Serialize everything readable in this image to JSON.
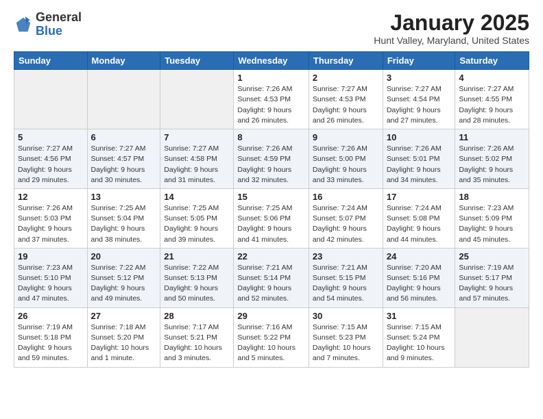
{
  "header": {
    "logo_general": "General",
    "logo_blue": "Blue",
    "month_title": "January 2025",
    "location": "Hunt Valley, Maryland, United States"
  },
  "weekdays": [
    "Sunday",
    "Monday",
    "Tuesday",
    "Wednesday",
    "Thursday",
    "Friday",
    "Saturday"
  ],
  "weeks": [
    [
      {
        "day": "",
        "content": ""
      },
      {
        "day": "",
        "content": ""
      },
      {
        "day": "",
        "content": ""
      },
      {
        "day": "1",
        "content": "Sunrise: 7:26 AM\nSunset: 4:53 PM\nDaylight: 9 hours\nand 26 minutes."
      },
      {
        "day": "2",
        "content": "Sunrise: 7:27 AM\nSunset: 4:53 PM\nDaylight: 9 hours\nand 26 minutes."
      },
      {
        "day": "3",
        "content": "Sunrise: 7:27 AM\nSunset: 4:54 PM\nDaylight: 9 hours\nand 27 minutes."
      },
      {
        "day": "4",
        "content": "Sunrise: 7:27 AM\nSunset: 4:55 PM\nDaylight: 9 hours\nand 28 minutes."
      }
    ],
    [
      {
        "day": "5",
        "content": "Sunrise: 7:27 AM\nSunset: 4:56 PM\nDaylight: 9 hours\nand 29 minutes."
      },
      {
        "day": "6",
        "content": "Sunrise: 7:27 AM\nSunset: 4:57 PM\nDaylight: 9 hours\nand 30 minutes."
      },
      {
        "day": "7",
        "content": "Sunrise: 7:27 AM\nSunset: 4:58 PM\nDaylight: 9 hours\nand 31 minutes."
      },
      {
        "day": "8",
        "content": "Sunrise: 7:26 AM\nSunset: 4:59 PM\nDaylight: 9 hours\nand 32 minutes."
      },
      {
        "day": "9",
        "content": "Sunrise: 7:26 AM\nSunset: 5:00 PM\nDaylight: 9 hours\nand 33 minutes."
      },
      {
        "day": "10",
        "content": "Sunrise: 7:26 AM\nSunset: 5:01 PM\nDaylight: 9 hours\nand 34 minutes."
      },
      {
        "day": "11",
        "content": "Sunrise: 7:26 AM\nSunset: 5:02 PM\nDaylight: 9 hours\nand 35 minutes."
      }
    ],
    [
      {
        "day": "12",
        "content": "Sunrise: 7:26 AM\nSunset: 5:03 PM\nDaylight: 9 hours\nand 37 minutes."
      },
      {
        "day": "13",
        "content": "Sunrise: 7:25 AM\nSunset: 5:04 PM\nDaylight: 9 hours\nand 38 minutes."
      },
      {
        "day": "14",
        "content": "Sunrise: 7:25 AM\nSunset: 5:05 PM\nDaylight: 9 hours\nand 39 minutes."
      },
      {
        "day": "15",
        "content": "Sunrise: 7:25 AM\nSunset: 5:06 PM\nDaylight: 9 hours\nand 41 minutes."
      },
      {
        "day": "16",
        "content": "Sunrise: 7:24 AM\nSunset: 5:07 PM\nDaylight: 9 hours\nand 42 minutes."
      },
      {
        "day": "17",
        "content": "Sunrise: 7:24 AM\nSunset: 5:08 PM\nDaylight: 9 hours\nand 44 minutes."
      },
      {
        "day": "18",
        "content": "Sunrise: 7:23 AM\nSunset: 5:09 PM\nDaylight: 9 hours\nand 45 minutes."
      }
    ],
    [
      {
        "day": "19",
        "content": "Sunrise: 7:23 AM\nSunset: 5:10 PM\nDaylight: 9 hours\nand 47 minutes."
      },
      {
        "day": "20",
        "content": "Sunrise: 7:22 AM\nSunset: 5:12 PM\nDaylight: 9 hours\nand 49 minutes."
      },
      {
        "day": "21",
        "content": "Sunrise: 7:22 AM\nSunset: 5:13 PM\nDaylight: 9 hours\nand 50 minutes."
      },
      {
        "day": "22",
        "content": "Sunrise: 7:21 AM\nSunset: 5:14 PM\nDaylight: 9 hours\nand 52 minutes."
      },
      {
        "day": "23",
        "content": "Sunrise: 7:21 AM\nSunset: 5:15 PM\nDaylight: 9 hours\nand 54 minutes."
      },
      {
        "day": "24",
        "content": "Sunrise: 7:20 AM\nSunset: 5:16 PM\nDaylight: 9 hours\nand 56 minutes."
      },
      {
        "day": "25",
        "content": "Sunrise: 7:19 AM\nSunset: 5:17 PM\nDaylight: 9 hours\nand 57 minutes."
      }
    ],
    [
      {
        "day": "26",
        "content": "Sunrise: 7:19 AM\nSunset: 5:18 PM\nDaylight: 9 hours\nand 59 minutes."
      },
      {
        "day": "27",
        "content": "Sunrise: 7:18 AM\nSunset: 5:20 PM\nDaylight: 10 hours\nand 1 minute."
      },
      {
        "day": "28",
        "content": "Sunrise: 7:17 AM\nSunset: 5:21 PM\nDaylight: 10 hours\nand 3 minutes."
      },
      {
        "day": "29",
        "content": "Sunrise: 7:16 AM\nSunset: 5:22 PM\nDaylight: 10 hours\nand 5 minutes."
      },
      {
        "day": "30",
        "content": "Sunrise: 7:15 AM\nSunset: 5:23 PM\nDaylight: 10 hours\nand 7 minutes."
      },
      {
        "day": "31",
        "content": "Sunrise: 7:15 AM\nSunset: 5:24 PM\nDaylight: 10 hours\nand 9 minutes."
      },
      {
        "day": "",
        "content": ""
      }
    ]
  ]
}
